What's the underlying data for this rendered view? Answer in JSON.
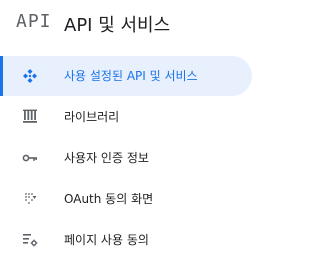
{
  "header": {
    "logo_text": "API",
    "title": "API 및 서비스"
  },
  "nav": {
    "items": [
      {
        "label": "사용 설정된 API 및 서비스",
        "icon": "api-dashboard-icon",
        "active": true
      },
      {
        "label": "라이브러리",
        "icon": "library-icon",
        "active": false
      },
      {
        "label": "사용자 인증 정보",
        "icon": "key-icon",
        "active": false
      },
      {
        "label": "OAuth 동의 화면",
        "icon": "oauth-consent-icon",
        "active": false
      },
      {
        "label": "페이지 사용 동의",
        "icon": "page-usage-settings-icon",
        "active": false
      }
    ]
  },
  "colors": {
    "accent": "#1a73e8",
    "active_bg": "#e8f0fe",
    "text": "#202124",
    "icon": "#5f6368"
  }
}
